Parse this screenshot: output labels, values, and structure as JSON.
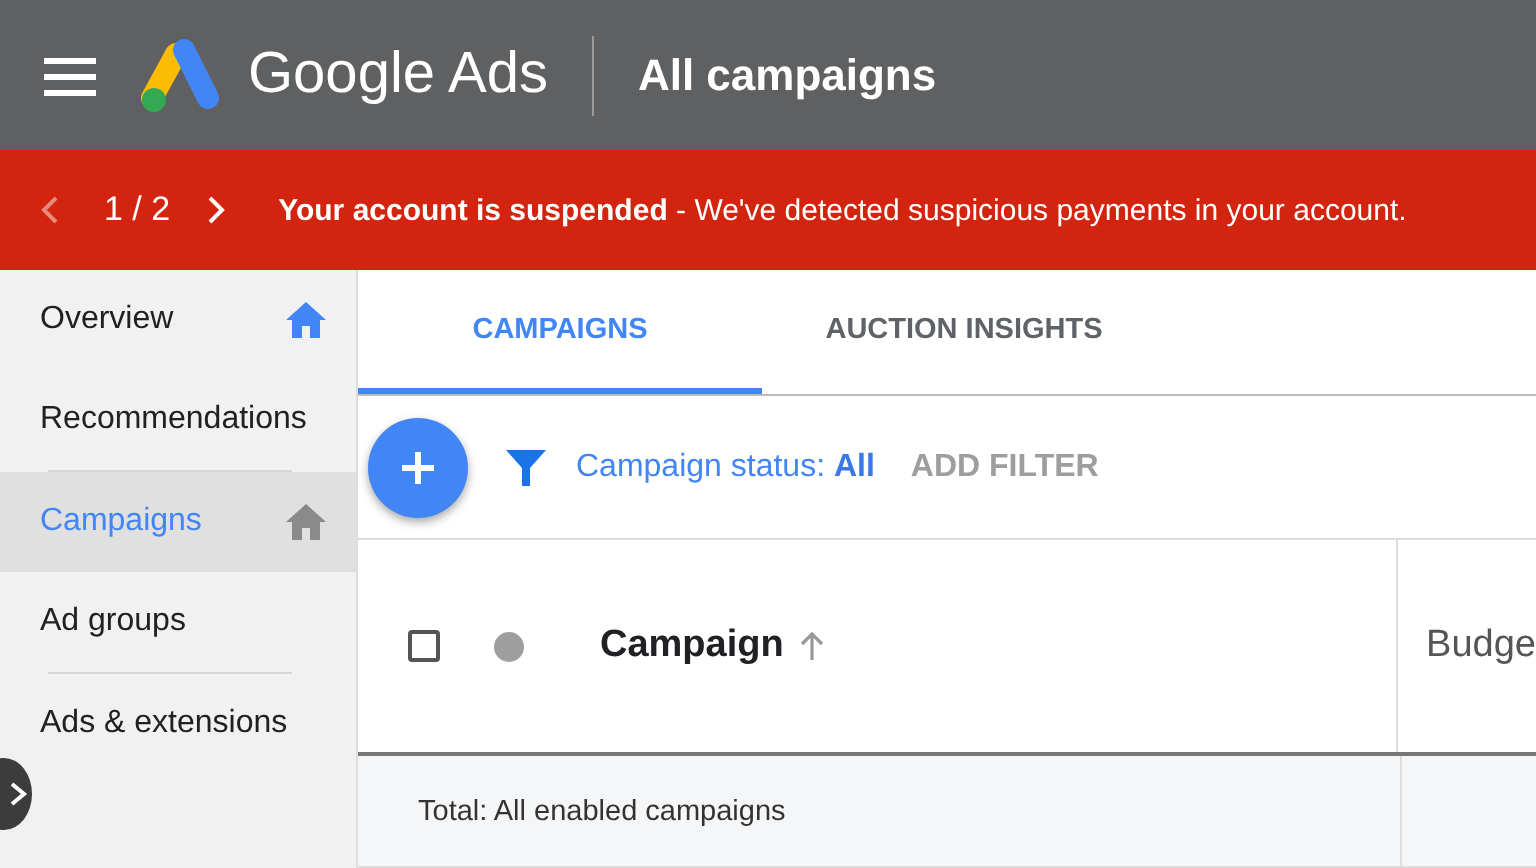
{
  "header": {
    "product": "Google Ads",
    "page_title": "All campaigns"
  },
  "banner": {
    "prev_disabled": true,
    "pager": "1 / 2",
    "message": "**Your account is suspended** - We've detected suspicious payments in your account."
  },
  "sidebar": {
    "items": [
      {
        "label": "Overview",
        "selected": false,
        "home_icon": true,
        "divider_before": false
      },
      {
        "label": "Recommendations",
        "selected": false,
        "home_icon": false,
        "divider_before": false
      },
      {
        "label": "Campaigns",
        "selected": true,
        "home_icon": true,
        "divider_before": true
      },
      {
        "label": "Ad groups",
        "selected": false,
        "home_icon": false,
        "divider_before": false
      },
      {
        "label": "Ads & extensions",
        "selected": false,
        "home_icon": false,
        "divider_before": true
      }
    ]
  },
  "tabs": [
    {
      "label": "CAMPAIGNS",
      "selected": true
    },
    {
      "label": "AUCTION INSIGHTS",
      "selected": false
    }
  ],
  "toolbar": {
    "status_filter": "Campaign status: **All**",
    "add_filter": "ADD FILTER"
  },
  "table": {
    "select_all_checked": false,
    "columns": [
      {
        "label": "Campaign",
        "sorted": true
      },
      {
        "label": "Budge",
        "sorted": false
      }
    ],
    "total_row": "Total: All enabled campaigns"
  }
}
